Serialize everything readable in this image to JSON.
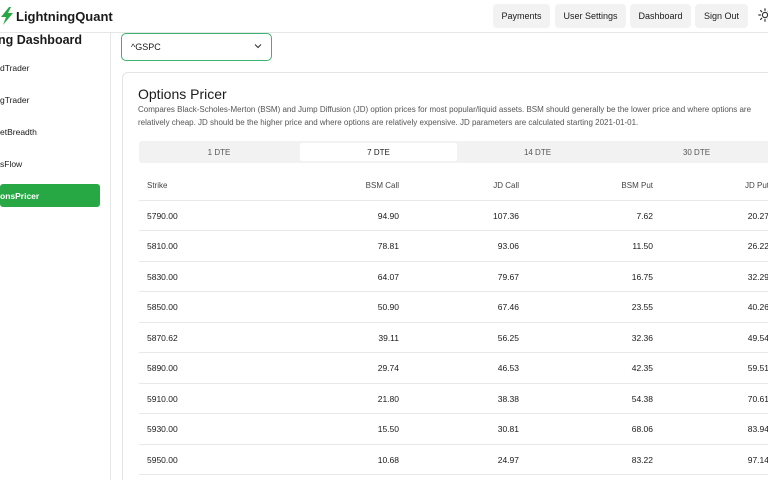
{
  "app": {
    "name": "LightningQuant",
    "accent": "#28a745"
  },
  "nav": {
    "payments": "Payments",
    "user_settings": "User Settings",
    "dashboard": "Dashboard",
    "sign_out": "Sign Out"
  },
  "sidebar": {
    "title": "ng Dashboard",
    "items": [
      {
        "label": "dTrader"
      },
      {
        "label": "gTrader"
      },
      {
        "label": "etBreadth"
      },
      {
        "label": "sFlow"
      },
      {
        "label": "onsPricer"
      }
    ]
  },
  "ticker": {
    "value": "^GSPC"
  },
  "pricer": {
    "title": "Options Pricer",
    "description": "Compares Black-Scholes-Merton (BSM) and Jump Diffusion (JD) option prices for most popular/liquid assets. BSM should generally be the lower price and where options are relatively cheap. JD should be the higher price and where options are relatively expensive. JD parameters are calculated starting 2021-01-01.",
    "tabs": [
      "1 DTE",
      "7 DTE",
      "14 DTE",
      "30 DTE"
    ],
    "active_tab": "7 DTE",
    "columns": [
      "Strike",
      "BSM Call",
      "JD Call",
      "BSM Put",
      "JD Put"
    ],
    "rows": [
      [
        "5790.00",
        "94.90",
        "107.36",
        "7.62",
        "20.27"
      ],
      [
        "5810.00",
        "78.81",
        "93.06",
        "11.50",
        "26.22"
      ],
      [
        "5830.00",
        "64.07",
        "79.67",
        "16.75",
        "32.29"
      ],
      [
        "5850.00",
        "50.90",
        "67.46",
        "23.55",
        "40.26"
      ],
      [
        "5870.62",
        "39.11",
        "56.25",
        "32.36",
        "49.54"
      ],
      [
        "5890.00",
        "29.74",
        "46.53",
        "42.35",
        "59.51"
      ],
      [
        "5910.00",
        "21.80",
        "38.38",
        "54.38",
        "70.61"
      ],
      [
        "5930.00",
        "15.50",
        "30.81",
        "68.06",
        "83.94"
      ],
      [
        "5950.00",
        "10.68",
        "24.97",
        "83.22",
        "97.14"
      ]
    ]
  }
}
